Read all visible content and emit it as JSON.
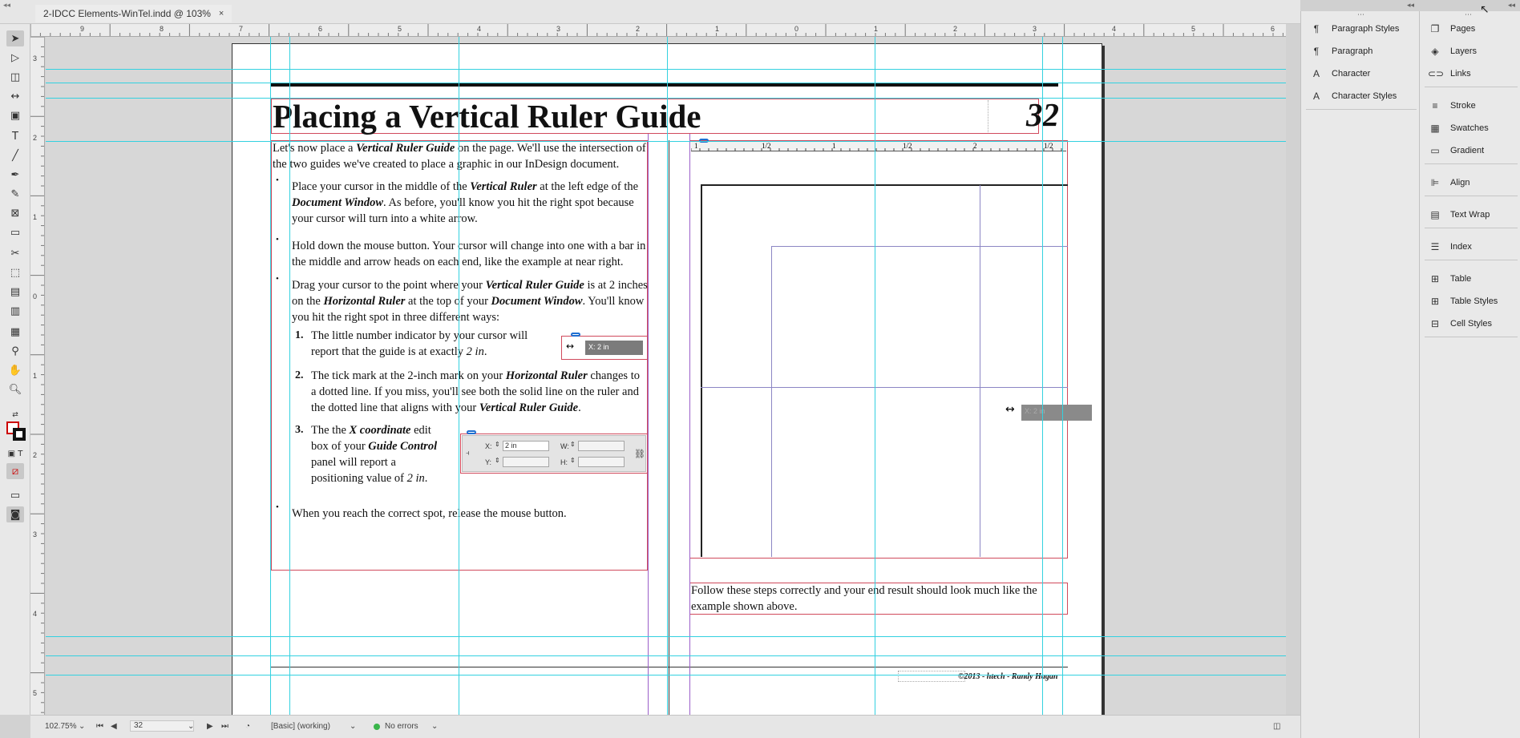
{
  "document_tab": {
    "title": "2-IDCC Elements-WinTel.indd @ 103%",
    "close_label": "×"
  },
  "toolbar": {
    "icons": [
      "selection-icon",
      "direct-selection-icon",
      "page-tool-icon",
      "gap-tool-icon",
      "content-collector-icon",
      "type-tool-icon",
      "line-tool-icon",
      "pen-tool-icon",
      "pencil-tool-icon",
      "rectangle-frame-icon",
      "rectangle-tool-icon",
      "scissors-icon",
      "free-transform-icon",
      "gradient-swatch-icon",
      "gradient-feather-icon",
      "note-tool-icon",
      "eyedropper-icon",
      "hand-tool-icon",
      "zoom-tool-icon"
    ]
  },
  "rulers": {
    "horizontal": [
      "9",
      "8",
      "7",
      "6",
      "5",
      "4",
      "3",
      "2",
      "1",
      "0",
      "1",
      "2",
      "3",
      "4",
      "5",
      "6"
    ],
    "vertical": [
      "3",
      "2",
      "1",
      "0",
      "1",
      "2",
      "3",
      "4",
      "5"
    ]
  },
  "page": {
    "title": "Placing a Vertical Ruler Guide",
    "page_number": "32",
    "intro": [
      "Let's now place a ",
      "Vertical Ruler Guide",
      " on the page. We'll use the intersection of the two guides we've created to place a graphic in our InDesign document."
    ],
    "bullets": [
      [
        "Place your cursor in the middle of the ",
        "Vertical Ruler",
        " at the left edge of the ",
        "Document Window",
        ". As before, you'll know you hit the right spot because your cursor will turn into a white arrow."
      ],
      [
        "Hold down the mouse button. Your cursor will change into one with a bar in the middle and arrow heads on each end, like the example at near right."
      ],
      [
        "Drag your cursor to the point where your ",
        "Vertical Ruler Guide",
        " is at 2 inches on the ",
        "Horizontal Ruler",
        " at the top of your ",
        "Document Window",
        ". You'll know you hit the right spot in three different ways:"
      ]
    ],
    "numbered": [
      {
        "num": "1.",
        "text": [
          "The little number indicator by your cursor will report that the guide is at exactly ",
          "2 in",
          "."
        ]
      },
      {
        "num": "2.",
        "text": [
          "The tick mark at the 2-inch mark on your ",
          "Horizontal Ruler",
          " changes to a dotted line. If you miss, you'll see both the solid line on the ruler and the dotted line that aligns with your ",
          "Vertical Ruler Guide",
          "."
        ]
      },
      {
        "num": "3.",
        "text": [
          "The the ",
          "X coordinate",
          " edit box of your ",
          "Guide Control",
          " panel will report a positioning value of ",
          "2 in",
          "."
        ]
      }
    ],
    "last_bullet": "When you reach the correct spot, release the mouse button.",
    "x_indicator": "X: 2 in",
    "x_indicator_ghost": "X: 2 in",
    "guide_control": {
      "x_label": "X:",
      "x_value": "2 in",
      "y_label": "Y:",
      "w_label": "W:",
      "h_label": "H:"
    },
    "illustration_ruler": [
      "1",
      "1/2",
      "1",
      "1/2",
      "2",
      "1/2"
    ],
    "caption": "Follow these steps correctly and your end result should look much like the example shown above.",
    "footer": "©2013 - htech - Randy Hagan"
  },
  "status_bar": {
    "zoom": "102.75%",
    "page": "32",
    "style": "[Basic] (working)",
    "preflight": "No errors"
  },
  "panels": {
    "left_column": [
      {
        "icon": "paragraph-styles-icon",
        "label": "Paragraph Styles"
      },
      {
        "icon": "paragraph-icon",
        "label": "Paragraph"
      },
      {
        "icon": "character-icon",
        "label": "Character"
      },
      {
        "icon": "character-styles-icon",
        "label": "Character Styles"
      }
    ],
    "right_column": [
      {
        "icon": "pages-icon",
        "label": "Pages"
      },
      {
        "icon": "layers-icon",
        "label": "Layers"
      },
      {
        "icon": "links-icon",
        "label": "Links"
      },
      {
        "icon": "stroke-icon",
        "label": "Stroke"
      },
      {
        "icon": "swatches-icon",
        "label": "Swatches"
      },
      {
        "icon": "gradient-icon",
        "label": "Gradient"
      },
      {
        "icon": "align-icon",
        "label": "Align"
      },
      {
        "icon": "text-wrap-icon",
        "label": "Text Wrap"
      },
      {
        "icon": "index-icon",
        "label": "Index"
      },
      {
        "icon": "table-icon",
        "label": "Table"
      },
      {
        "icon": "table-styles-icon",
        "label": "Table Styles"
      },
      {
        "icon": "cell-styles-icon",
        "label": "Cell Styles"
      }
    ]
  },
  "colors": {
    "guide": "#33d1e0",
    "frame": "#d04a5c",
    "margin": "#9b5fc9"
  }
}
